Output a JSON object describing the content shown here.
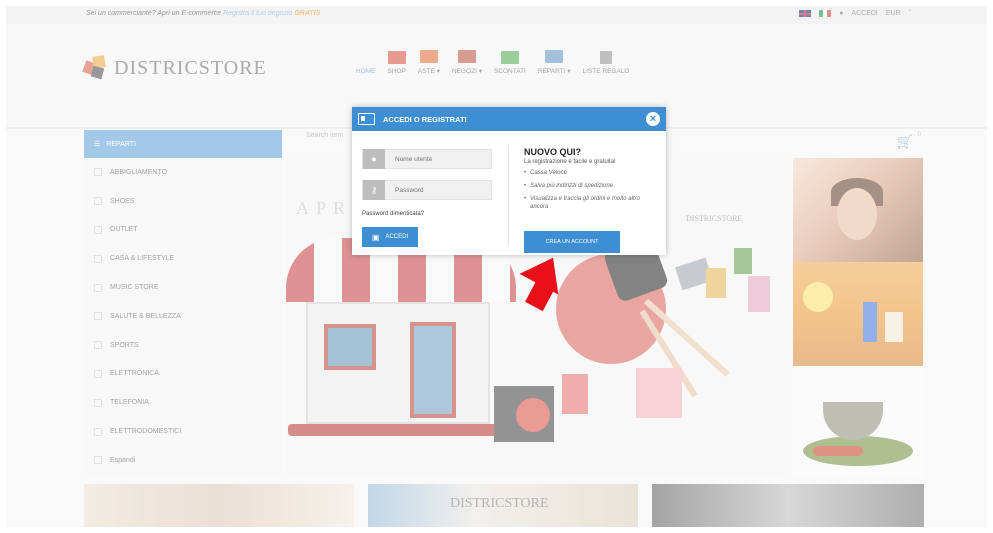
{
  "topbar": {
    "promo_text": "Sei un commerciante? Apri un E-commerce",
    "promo_link": "Registra il tuo negozio",
    "promo_free": "GRATIS",
    "login": "ACCEDI",
    "currency": "EUR"
  },
  "header": {
    "logo_text": "DISTRICSTORE",
    "nav": [
      {
        "label": "HOME",
        "active": true
      },
      {
        "label": "SHOP"
      },
      {
        "label": "ASTE ▾"
      },
      {
        "label": "NEGOZI ▾"
      },
      {
        "label": "SCONTATI"
      },
      {
        "label": "REPARTI ▾"
      },
      {
        "label": "LISTE REGALO"
      }
    ]
  },
  "reparti": {
    "title": "REPARTI",
    "search_placeholder": "Search item",
    "cart_count": "0",
    "items": [
      "ABBIGLIAMENTO",
      "SHOES",
      "OUTLET",
      "CASA & LIFESTYLE",
      "MUSIC STORE",
      "SALUTE & BELLEZZA",
      "SPORTS",
      "ELETTRONICA",
      "TELEFONIA",
      "ELETTRODOMESTICI",
      "Espandi"
    ]
  },
  "hero": {
    "apr_text": "APR",
    "mini_logo": "DISTRICSTORE"
  },
  "bottom": {
    "logo_text": "DISTRICSTORE"
  },
  "modal": {
    "title": "ACCEDI O REGISTRATI",
    "username_placeholder": "Nome utente",
    "password_placeholder": "Password",
    "forgot": "Password dimenticata?",
    "login_button": "ACCEDI",
    "new_heading": "NUOVO QUI?",
    "new_sub": "La registrazione è facile e gratuita!",
    "benefits": [
      "Cassa Veloce",
      "Salva più indirizzi di spedizione",
      "Visualizza e traccia gli ordini e molto altro ancora"
    ],
    "create_button": "CREA UN ACCOUNT"
  },
  "colors": {
    "accent": "#3d8ed2",
    "arrow": "#e8101a",
    "awning_red": "#c43a3a"
  }
}
